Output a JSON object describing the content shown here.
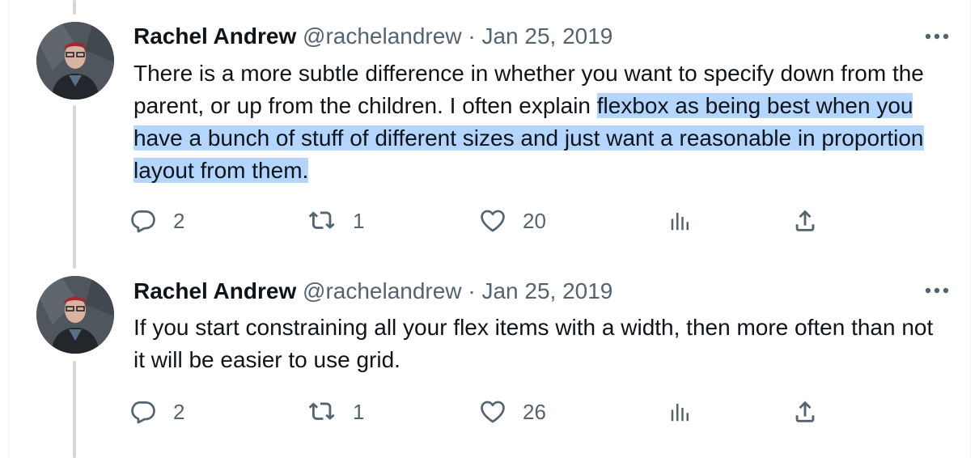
{
  "tweets": [
    {
      "author_name": "Rachel Andrew",
      "handle": "@rachelandrew",
      "separator": "·",
      "date": "Jan 25, 2019",
      "text_plain": "There is a more subtle difference in whether you want to specify down from the parent, or up from the children. I often explain ",
      "text_highlighted": "flexbox as being best when you have a bunch of stuff of different sizes and just want a reasonable in proportion layout from them.",
      "replies": "2",
      "retweets": "1",
      "likes": "20"
    },
    {
      "author_name": "Rachel Andrew",
      "handle": "@rachelandrew",
      "separator": "·",
      "date": "Jan 25, 2019",
      "text_plain": "If you start constraining all your flex items with a width, then more often than not it will be easier to use grid.",
      "text_highlighted": "",
      "replies": "2",
      "retweets": "1",
      "likes": "26"
    }
  ],
  "icons": [
    "more-icon",
    "reply-icon",
    "retweet-icon",
    "like-icon",
    "views-icon",
    "share-icon"
  ],
  "colors": {
    "text": "#0f1419",
    "secondary": "#536471",
    "highlight": "#b4d5fe",
    "thread_line": "#cfd9de"
  }
}
